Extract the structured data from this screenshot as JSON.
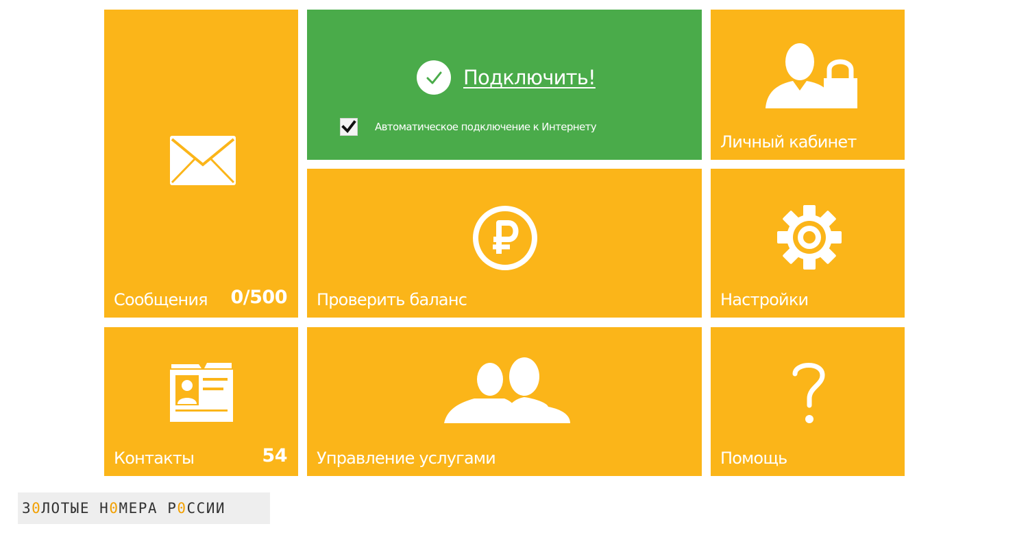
{
  "tiles": {
    "messages": {
      "label": "Сообщения",
      "count": "0/500",
      "icon": "envelope-icon"
    },
    "connect": {
      "link_label": "Подключить!",
      "auto_connect_label": "Автоматическое подключение к Интернету",
      "auto_connect_checked": true,
      "icon": "check-circle-icon"
    },
    "account": {
      "label": "Личный кабинет",
      "icon": "user-lock-icon"
    },
    "balance": {
      "label": "Проверить баланс",
      "icon": "ruble-icon"
    },
    "settings": {
      "label": "Настройки",
      "icon": "gear-icon"
    },
    "contacts": {
      "label": "Контакты",
      "count": "54",
      "icon": "contact-card-icon"
    },
    "services": {
      "label": "Управление услугами",
      "icon": "users-icon"
    },
    "help": {
      "label": "Помощь",
      "icon": "question-icon"
    }
  },
  "logo": {
    "parts": [
      "З",
      "0",
      "ЛОТЫЕ Н",
      "0",
      "МЕРА Р",
      "0",
      "ССИИ"
    ]
  },
  "colors": {
    "tile_yellow": "#fbb519",
    "tile_green": "#4aab4a",
    "logo_accent": "#f2a000"
  }
}
